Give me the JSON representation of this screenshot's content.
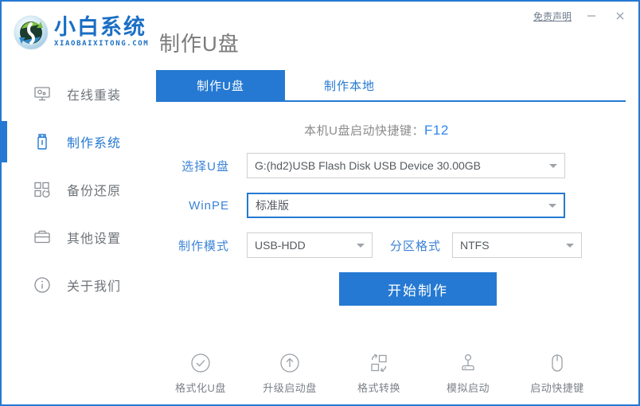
{
  "window": {
    "title": "制作U盘",
    "accent_color": "#2579d2",
    "border_color": "#2579d2"
  },
  "brand": {
    "name_cn": "小白系统",
    "name_en": "XIAOBAIXITONG.COM",
    "logo_icon": "recycle-circle-logo"
  },
  "titlebar": {
    "disclaimer_label": "免责声明",
    "minimize_icon": "minimize-icon",
    "close_icon": "close-icon"
  },
  "sidebar": {
    "items": [
      {
        "label": "在线重装",
        "icon": "monitor-icon",
        "active": false
      },
      {
        "label": "制作系统",
        "icon": "usb-drive-icon",
        "active": true
      },
      {
        "label": "备份还原",
        "icon": "backup-restore-icon",
        "active": false
      },
      {
        "label": "其他设置",
        "icon": "briefcase-icon",
        "active": false
      },
      {
        "label": "关于我们",
        "icon": "info-circle-icon",
        "active": false
      }
    ]
  },
  "main": {
    "tabs": [
      {
        "label": "制作U盘",
        "active": true
      },
      {
        "label": "制作本地",
        "active": false
      }
    ],
    "hint": {
      "text": "本机U盘启动快捷键：",
      "key": "F12",
      "key_color": "#2f86f2"
    },
    "form": {
      "usb_label": "选择U盘",
      "usb_value": "G:(hd2)USB Flash Disk USB Device 30.00GB",
      "winpe_label": "WinPE",
      "winpe_value": "标准版",
      "mode_label": "制作模式",
      "mode_value": "USB-HDD",
      "partition_label": "分区格式",
      "partition_value": "NTFS"
    },
    "submit_label": "开始制作"
  },
  "tools": [
    {
      "label": "格式化U盘",
      "icon": "check-circle-icon"
    },
    {
      "label": "升级启动盘",
      "icon": "arrow-up-circle-icon"
    },
    {
      "label": "格式转换",
      "icon": "format-convert-icon"
    },
    {
      "label": "模拟启动",
      "icon": "joystick-icon"
    },
    {
      "label": "启动快捷键",
      "icon": "mouse-icon"
    }
  ]
}
